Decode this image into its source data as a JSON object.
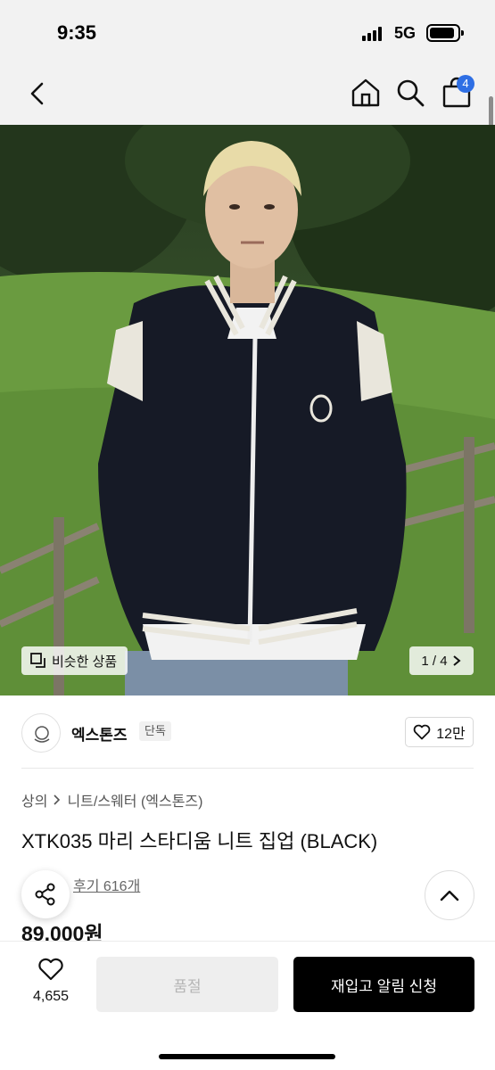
{
  "status_bar": {
    "time": "9:35",
    "network": "5G",
    "icons": [
      "signal-icon",
      "battery-icon"
    ]
  },
  "navbar": {
    "icons": [
      "back-icon",
      "home-icon",
      "search-icon",
      "bag-icon"
    ],
    "cart_count": "4"
  },
  "hero": {
    "similar_label": "비슷한 상품",
    "pager": "1 / 4"
  },
  "brand": {
    "name": "엑스톤즈",
    "tag": "단독",
    "likes": "12만"
  },
  "product": {
    "breadcrumb": [
      "상의",
      "니트/스웨터 (엑스톤즈)"
    ],
    "title": "XTK035 마리 스타디움 니트 집업 (BLACK)",
    "review_link": "후기 616개",
    "price": "89,000원"
  },
  "bottom": {
    "like_count": "4,655",
    "soldout_label": "품절",
    "restock_label": "재입고 알림 신청"
  },
  "colors": {
    "accent_badge": "#2f6fe4",
    "primary_button": "#000000",
    "disabled_button": "#eeeeee"
  }
}
